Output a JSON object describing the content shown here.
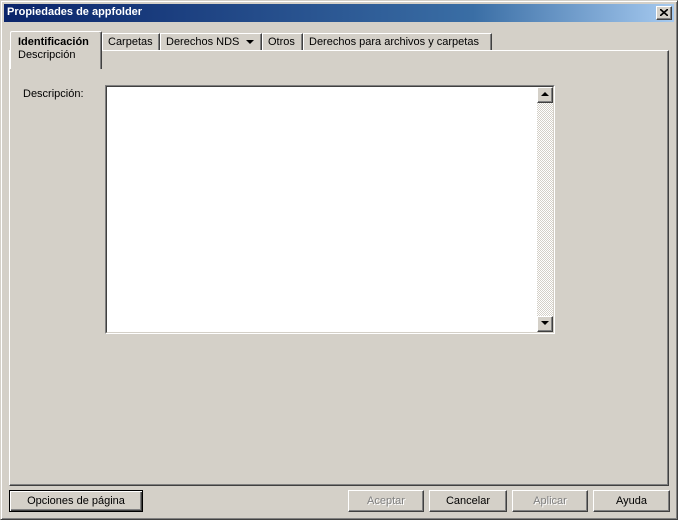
{
  "window": {
    "title": "Propiedades de appfolder"
  },
  "tabs": [
    {
      "label": "Identificación",
      "sublabel": "Descripción",
      "active": true
    },
    {
      "label": "Carpetas"
    },
    {
      "label": "Derechos NDS",
      "has_dropdown": true
    },
    {
      "label": "Otros"
    },
    {
      "label": "Derechos para archivos y carpetas"
    }
  ],
  "form": {
    "description_label": "Descripción:",
    "description_value": ""
  },
  "buttons": {
    "page_options": "Opciones de página",
    "accept": "Aceptar",
    "cancel": "Cancelar",
    "apply": "Aplicar",
    "help": "Ayuda"
  },
  "icons": {
    "close": "close-icon",
    "tab_dropdown": "chevron-down-icon",
    "scroll_up": "arrow-up-icon",
    "scroll_down": "arrow-down-icon"
  },
  "colors": {
    "titlebar_start": "#0a246a",
    "titlebar_end": "#a6caf0",
    "face": "#d4d0c8",
    "disabled_text": "#808080"
  }
}
